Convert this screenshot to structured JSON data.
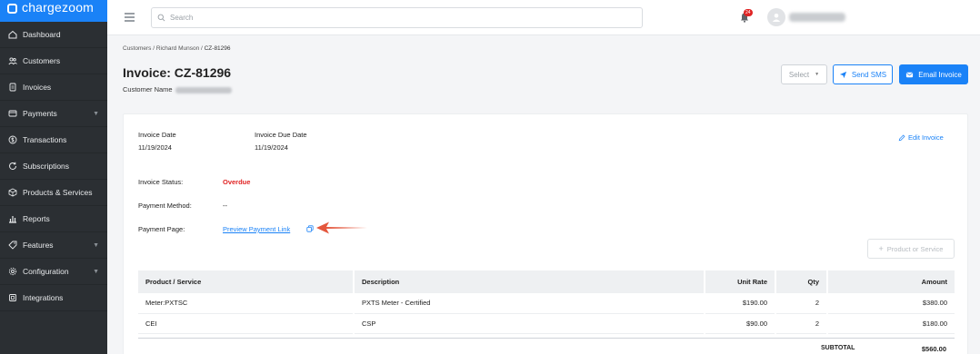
{
  "brand": {
    "name": "chargezoom"
  },
  "sidebar": {
    "items": [
      {
        "label": "Dashboard",
        "icon": "home-icon",
        "has_chevron": false
      },
      {
        "label": "Customers",
        "icon": "users-icon",
        "has_chevron": false
      },
      {
        "label": "Invoices",
        "icon": "invoice-icon",
        "has_chevron": false
      },
      {
        "label": "Payments",
        "icon": "payments-icon",
        "has_chevron": true
      },
      {
        "label": "Transactions",
        "icon": "dollar-circle-icon",
        "has_chevron": false
      },
      {
        "label": "Subscriptions",
        "icon": "refresh-icon",
        "has_chevron": false
      },
      {
        "label": "Products & Services",
        "icon": "box-icon",
        "has_chevron": false
      },
      {
        "label": "Reports",
        "icon": "bar-chart-icon",
        "has_chevron": false
      },
      {
        "label": "Features",
        "icon": "tag-icon",
        "has_chevron": true
      },
      {
        "label": "Configuration",
        "icon": "gear-icon",
        "has_chevron": true
      },
      {
        "label": "Integrations",
        "icon": "integrations-icon",
        "has_chevron": false
      }
    ]
  },
  "topbar": {
    "search_placeholder": "Search",
    "notification_count": "24"
  },
  "breadcrumb": {
    "customers": "Customers",
    "separator": " / ",
    "customer": "Richard Munson",
    "current": "CZ-81296"
  },
  "header": {
    "title": "Invoice: CZ-81296",
    "customer_name_label": "Customer Name"
  },
  "actions": {
    "select_label": "Select",
    "send_sms_label": "Send SMS",
    "email_invoice_label": "Email Invoice"
  },
  "invoice": {
    "invoice_date_label": "Invoice Date",
    "invoice_date": "11/19/2024",
    "due_date_label": "Invoice Due Date",
    "due_date": "11/19/2024",
    "edit_label": "Edit Invoice",
    "status_label": "Invoice Status:",
    "status": "Overdue",
    "payment_method_label": "Payment Method:",
    "payment_method": "--",
    "payment_page_label": "Payment Page:",
    "payment_page_link": "Preview Payment Link",
    "add_product_label": "Product or Service"
  },
  "table": {
    "headers": [
      "Product / Service",
      "Description",
      "Unit Rate",
      "Qty",
      "Amount"
    ],
    "rows": [
      {
        "product": "Meter:PXTSC",
        "description": "PXTS Meter - Certified",
        "unit_rate": "$190.00",
        "qty": "2",
        "amount": "$380.00"
      },
      {
        "product": "CEI",
        "description": "CSP",
        "unit_rate": "$90.00",
        "qty": "2",
        "amount": "$180.00"
      }
    ],
    "subtotal_label": "SUBTOTAL",
    "subtotal_value": "$560.00"
  },
  "colors": {
    "accent": "#1a82f7",
    "sidebar_bg": "#2b2f33",
    "overdue": "#e02424",
    "arrow": "#e4573d"
  }
}
